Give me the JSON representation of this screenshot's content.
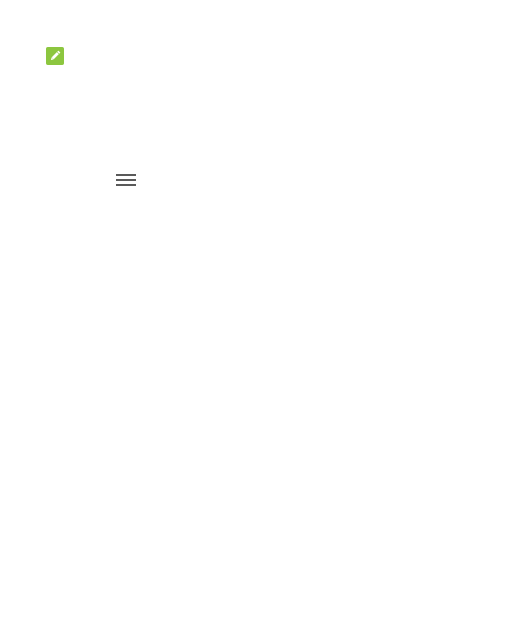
{
  "icons": {
    "note": {
      "name": "pencil-icon",
      "color": "#8CC63F"
    },
    "menu": {
      "name": "menu-icon",
      "color": "#5A5A5A"
    }
  }
}
